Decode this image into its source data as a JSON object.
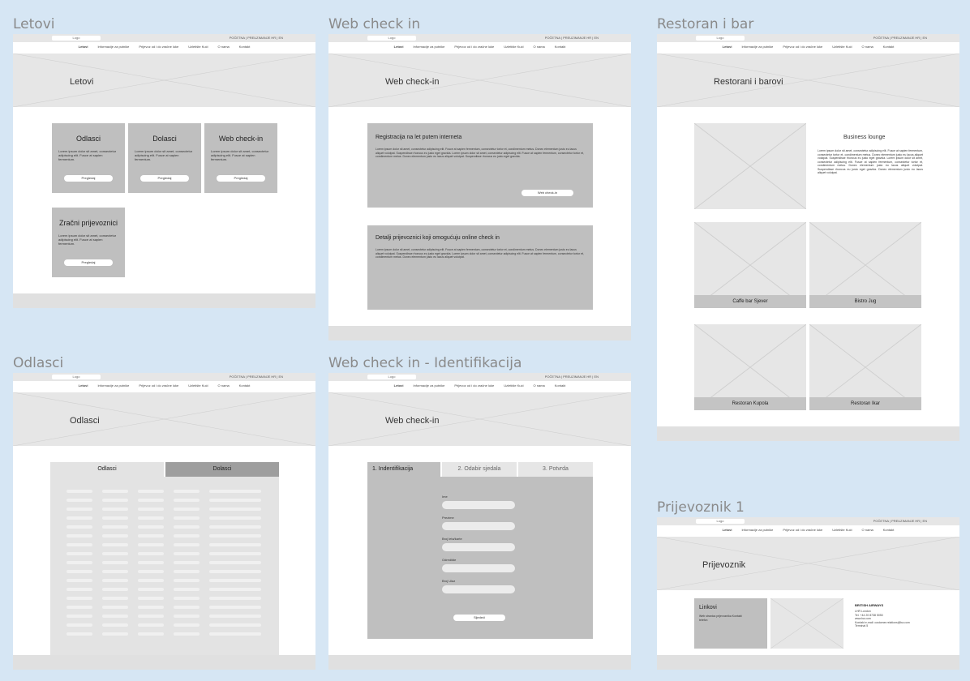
{
  "frames": {
    "letovi": {
      "title": "Letovi",
      "hero": "Letovi",
      "cards": [
        {
          "title": "Odlasci",
          "text": "Lorem ipsum dolor sit amet, consectetur adipiscing elit. Fusce at sapien fermentum.",
          "btn": "Pregledaj"
        },
        {
          "title": "Dolasci",
          "text": "Lorem ipsum dolor sit amet, consectetur adipiscing elit. Fusce at sapien fermentum.",
          "btn": "Pregledaj"
        },
        {
          "title": "Web check-in",
          "text": "Lorem ipsum dolor sit amet, consectetur adipiscing elit. Fusce at sapien fermentum.",
          "btn": "Pregledaj"
        },
        {
          "title": "Zračni prijevoznici",
          "text": "Lorem ipsum dolor sit amet, consectetur adipiscing elit. Fusce at sapien fermentum.",
          "btn": "Pregledaj"
        }
      ]
    },
    "webcheck": {
      "title": "Web check in",
      "hero": "Web check-in",
      "box1_title": "Registracija na let putem interneta",
      "box1_text": "Lorem ipsum dolor sit amet, consectetur adipiscing elit. Fusce at sapien fermentum, consectetur tortor et, condimentum metus. Donec elementum justo eu lacus aliquet volutpat. Suspendisse rhoncus eu justo eget gravida. Lorem ipsum dolor sit amet, consectetur adipiscing elit. Fusce at sapien fermentum, consectetur tortor et, condimentum metus. Donec elementum justo eu lacus aliquet volutpat. Suspendisse rhoncus eu justo eget gravida.",
      "box1_btn": "Web check-in",
      "box2_title": "Detalji prijevoznici koji omogućuju online check in",
      "box2_text": "Lorem ipsum dolor sit amet, consectetur adipiscing elit. Fusce at sapien fermentum, consectetur tortor et, condimentum metus. Donec elementum justo eu lacus aliquet volutpat. Suspendisse rhoncus eu justo eget gravida. Lorem ipsum dolor sit amet, consectetur adipiscing elit. Fusce at sapien fermentum, consectetur tortor et, condimentum metus. Donec elementum justo eu lacus aliquet volutpat."
    },
    "restoran": {
      "title": "Restoran i bar",
      "hero": "Restorani i barovi",
      "lounge_title": "Business lounge",
      "lounge_text": "Lorem ipsum dolor sit amet, consectetur adipiscing elit. Fusce at sapien fermentum, consectetur tortor et, condimentum metus. Donec elementum justo eu lacus aliquet volutpat. Suspendisse rhoncus eu justo eget gravida. Lorem ipsum dolor sit amet, consectetur adipiscing elit. Fusce at sapien fermentum, consectetur tortor et, condimentum metus. Donec elementum justo eu lacus aliquet volutpat. Suspendisse rhoncus eu justo eget gravida. Donec elementum justo eu lacus aliquet volutpat.",
      "places": [
        "Caffe bar Sjever",
        "Bistro Jug",
        "Restoran Kupola",
        "Restoran Ikar"
      ]
    },
    "odlasci": {
      "title": "Odlasci",
      "hero": "Odlasci",
      "tab_a": "Odlasci",
      "tab_b": "Dolasci"
    },
    "identifikacija": {
      "title": "Web check in - Identifikacija",
      "hero": "Web check-in",
      "tabs": [
        "1. Indentifikacija",
        "2. Odabir sjedala",
        "3. Potvrda"
      ],
      "fields": [
        "Ime",
        "Prezime",
        "Broj leta/karte",
        "Odredište",
        "Broj Ulaz"
      ],
      "btn": "Sljedeći"
    },
    "prijevoznik": {
      "title": "Prijevoznik 1",
      "hero": "Prijevoznik",
      "card_title": "Linkovi",
      "card_text": "Web stranica prijevoznika Kontakt telefon",
      "info_title": "BRITISH AIRWAYS",
      "info_lines": [
        "LHR London",
        "Tel. +44 20 8738 5050",
        "www.ba.com",
        "Kontakt e-mail: customer.relations@ba.com",
        "Terminal 5"
      ]
    }
  },
  "common": {
    "logo": "Logo",
    "toplinks": "POČETNA | PREUZIMANJE  HR | EN",
    "nav": [
      "Letovi",
      "Informacije za putnike",
      "Prijevoz od i do zračne luke",
      "Uzletište Kući",
      "O nama",
      "Kontakt"
    ]
  }
}
